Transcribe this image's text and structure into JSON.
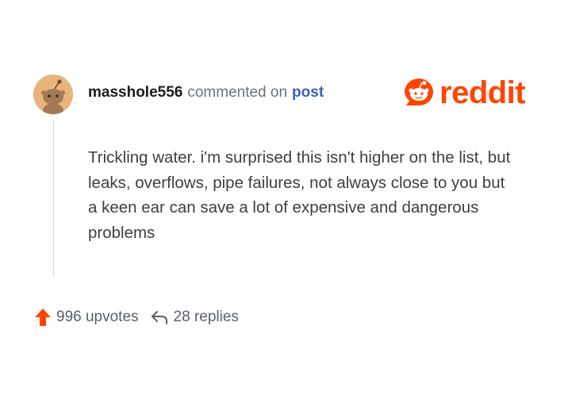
{
  "comment": {
    "username": "masshole556",
    "action": "commented on",
    "link_text": "post",
    "body": "Trickling water. i'm surprised this isn't higher on the list, but leaks, overflows, pipe failures, not always close to you but a keen ear can save a lot of expensive and dangerous problems"
  },
  "brand": {
    "name": "reddit",
    "color": "#ff4500",
    "icon": "reddit-snoo-icon"
  },
  "footer": {
    "upvotes_label": "996 upvotes",
    "replies_label": "28 replies",
    "upvote_icon": "upvote-arrow-icon",
    "reply_icon": "reply-arrow-icon"
  },
  "colors": {
    "accent": "#ff4500",
    "link": "#3a5fbe",
    "avatar_bg": "#e8b47c"
  }
}
